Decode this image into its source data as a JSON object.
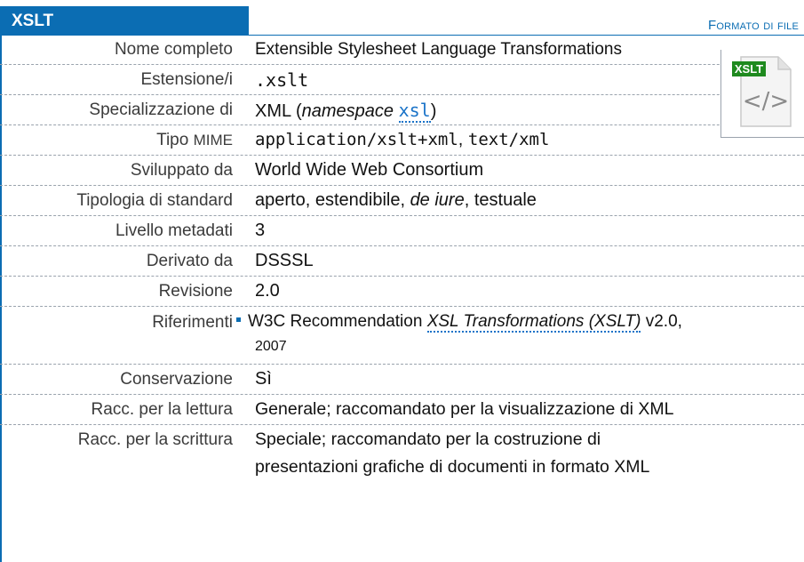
{
  "header": {
    "title": "XSLT",
    "category": "Formato di file"
  },
  "icon": {
    "name": "xml-file-icon",
    "badge": "XSLT",
    "glyph": "</>",
    "badge_color": "#1f8a1f"
  },
  "rows": {
    "nome": {
      "label": "Nome completo",
      "value": "Extensible Stylesheet Language Transformations"
    },
    "estensione": {
      "label": "Estensione/i",
      "value": ".xslt"
    },
    "specializzazione": {
      "label": "Specializzazione di",
      "value_prefix": "XML (",
      "value_italic": "namespace",
      "value_link": "xsl",
      "value_suffix": ")"
    },
    "mime": {
      "label_prefix": "Tipo ",
      "label_abbr": "MIME",
      "value_1": "application/xslt+xml",
      "separator": ",",
      "value_2": "text/xml"
    },
    "sviluppato": {
      "label": "Sviluppato da",
      "value": "World Wide Web Consortium"
    },
    "tipologia": {
      "label": "Tipologia di standard",
      "value_prefix": "aperto, estendibile, ",
      "value_italic": "de iure",
      "value_suffix": ", testuale"
    },
    "livello": {
      "label": "Livello metadati",
      "value": "3"
    },
    "derivato": {
      "label": "Derivato da",
      "value": "DSSSL"
    },
    "revisione": {
      "label": "Revisione",
      "value": "2.0"
    },
    "riferimenti": {
      "label": "Riferimenti",
      "value_prefix": "W3C Recommendation ",
      "value_link": "XSL Transformations (XSLT)",
      "value_suffix": " v2.0,",
      "value_line2": "2007"
    },
    "conservazione": {
      "label": "Conservazione",
      "value": "Sì"
    },
    "lettura": {
      "label": "Racc. per la lettura",
      "value": "Generale; raccomandato per la visualizzazione di XML"
    },
    "scrittura": {
      "label": "Racc. per la scrittura",
      "value_line1": "Speciale; raccomandato per la costruzione di",
      "value_line2": "presentazioni grafiche di documenti in formato XML"
    }
  }
}
